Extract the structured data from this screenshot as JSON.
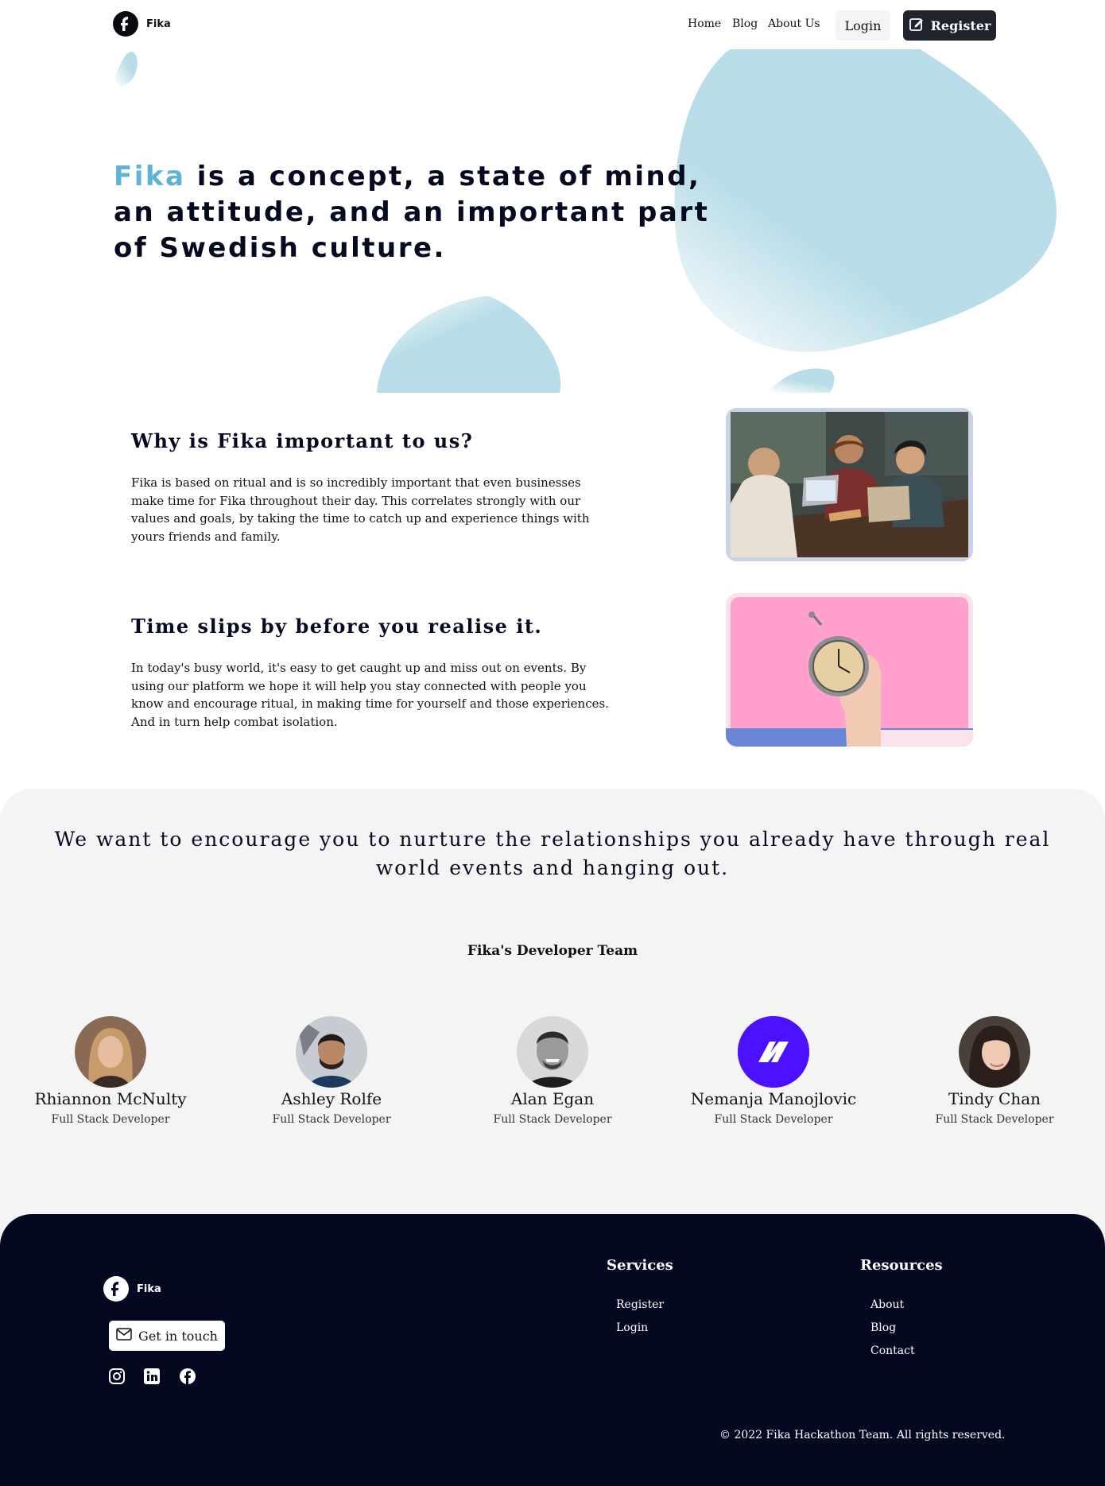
{
  "nav": {
    "brand": "Fika",
    "links": [
      "Home",
      "Blog",
      "About Us"
    ],
    "login_label": "Login",
    "register_label": "Register"
  },
  "hero": {
    "brand_word": "Fika",
    "title_rest": " is a concept, a state of mind, an attitude, and an important part of Swedish culture."
  },
  "features": [
    {
      "title": "Why is Fika important to us?",
      "text": "Fika is based on ritual and is so incredibly important that even businesses make time for Fika throughout their day. This correlates strongly with our values and goals, by taking the time to catch up and experience things with yours friends and family."
    },
    {
      "title": "Time slips by before you realise it.",
      "text": "In today's busy world, it's easy to get caught up and miss out on events. By using our platform we hope it will help you stay connected with people you know and encourage ritual, in making time for yourself and those experiences. And in turn help combat isolation."
    }
  ],
  "mission": "We want to encourage you to nurture the relationships you already have through real world events and hanging out.",
  "team": {
    "heading": "Fika's Developer Team",
    "members": [
      {
        "name": "Rhiannon McNulty",
        "role": "Full Stack Developer"
      },
      {
        "name": "Ashley Rolfe",
        "role": "Full Stack Developer"
      },
      {
        "name": "Alan Egan",
        "role": "Full Stack Developer"
      },
      {
        "name": "Nemanja Manojlovic",
        "role": "Full Stack Developer"
      },
      {
        "name": "Tindy Chan",
        "role": "Full Stack Developer"
      }
    ]
  },
  "footer": {
    "brand": "Fika",
    "contact_label": "Get in touch",
    "social_icons": [
      "instagram-icon",
      "linkedin-icon",
      "facebook-icon"
    ],
    "services": {
      "heading": "Services",
      "links": [
        "Register",
        "Login"
      ]
    },
    "resources": {
      "heading": "Resources",
      "links": [
        "About",
        "Blog",
        "Contact"
      ]
    },
    "copyright": "© 2022 Fika Hackathon Team. All rights reserved."
  },
  "colors": {
    "accent": "#5fb4d4",
    "dark": "#050821",
    "blob": "#b9dde8",
    "pink_card": "#ff9fcc",
    "blue_card": "#7a9be0"
  }
}
